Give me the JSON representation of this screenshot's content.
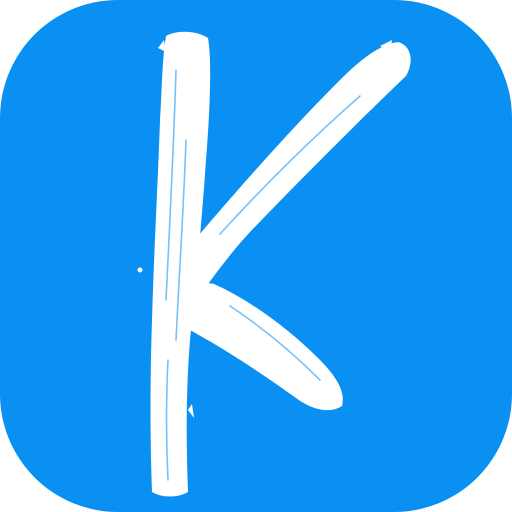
{
  "app_icon": {
    "letter": "K",
    "background_color": "#0A8FF2",
    "glyph_color": "#FFFFFF",
    "glyph_style": "brush-stroke"
  }
}
